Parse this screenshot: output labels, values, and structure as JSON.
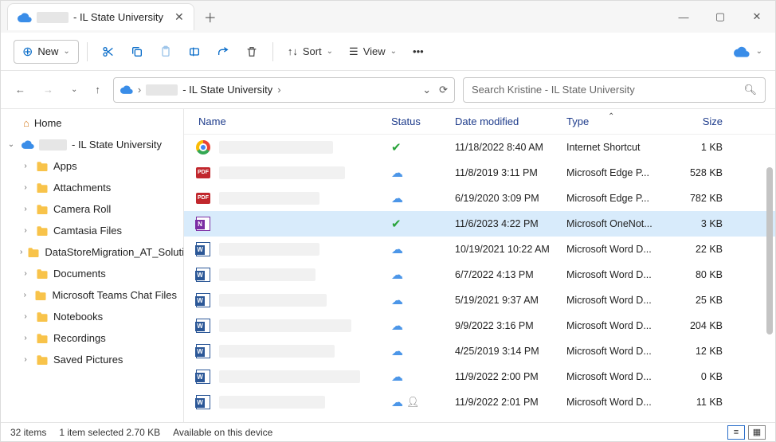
{
  "tab": {
    "prefix": "",
    "suffix": "- IL State University"
  },
  "toolbar": {
    "new": "New",
    "sort": "Sort",
    "view": "View"
  },
  "path": {
    "suffix": "- IL State University"
  },
  "search": {
    "placeholder": "Search Kristine - IL State University"
  },
  "sidebar": {
    "home": "Home",
    "onedrive": "- IL State University",
    "folders": [
      "Apps",
      "Attachments",
      "Camera Roll",
      "Camtasia Files",
      "DataStoreMigration_AT_Solutions",
      "Documents",
      "Microsoft Teams Chat Files",
      "Notebooks",
      "Recordings",
      "Saved Pictures"
    ]
  },
  "columns": {
    "name": "Name",
    "status": "Status",
    "date": "Date modified",
    "type": "Type",
    "size": "Size"
  },
  "rows": [
    {
      "icon": "chrome",
      "status": "check",
      "date": "11/18/2022 8:40 AM",
      "type": "Internet Shortcut",
      "size": "1 KB",
      "selected": false
    },
    {
      "icon": "pdf",
      "status": "cloud",
      "date": "11/8/2019 3:11 PM",
      "type": "Microsoft Edge P...",
      "size": "528 KB",
      "selected": false
    },
    {
      "icon": "pdf",
      "status": "cloud",
      "date": "6/19/2020 3:09 PM",
      "type": "Microsoft Edge P...",
      "size": "782 KB",
      "selected": false
    },
    {
      "icon": "onenote",
      "status": "check",
      "date": "11/6/2023 4:22 PM",
      "type": "Microsoft OneNot...",
      "size": "3 KB",
      "selected": true
    },
    {
      "icon": "word",
      "status": "cloud",
      "date": "10/19/2021 10:22 AM",
      "type": "Microsoft Word D...",
      "size": "22 KB",
      "selected": false
    },
    {
      "icon": "word",
      "status": "cloud",
      "date": "6/7/2022 4:13 PM",
      "type": "Microsoft Word D...",
      "size": "80 KB",
      "selected": false
    },
    {
      "icon": "word",
      "status": "cloud",
      "date": "5/19/2021 9:37 AM",
      "type": "Microsoft Word D...",
      "size": "25 KB",
      "selected": false
    },
    {
      "icon": "word",
      "status": "cloud",
      "date": "9/9/2022 3:16 PM",
      "type": "Microsoft Word D...",
      "size": "204 KB",
      "selected": false
    },
    {
      "icon": "word",
      "status": "cloud",
      "date": "4/25/2019 3:14 PM",
      "type": "Microsoft Word D...",
      "size": "12 KB",
      "selected": false
    },
    {
      "icon": "word",
      "status": "cloud",
      "date": "11/9/2022 2:00 PM",
      "type": "Microsoft Word D...",
      "size": "0 KB",
      "selected": false
    },
    {
      "icon": "word",
      "status": "cloud-shared",
      "date": "11/9/2022 2:01 PM",
      "type": "Microsoft Word D...",
      "size": "11 KB",
      "selected": false
    }
  ],
  "statusbar": {
    "count": "32 items",
    "selection": "1 item selected  2.70 KB",
    "availability": "Available on this device"
  }
}
